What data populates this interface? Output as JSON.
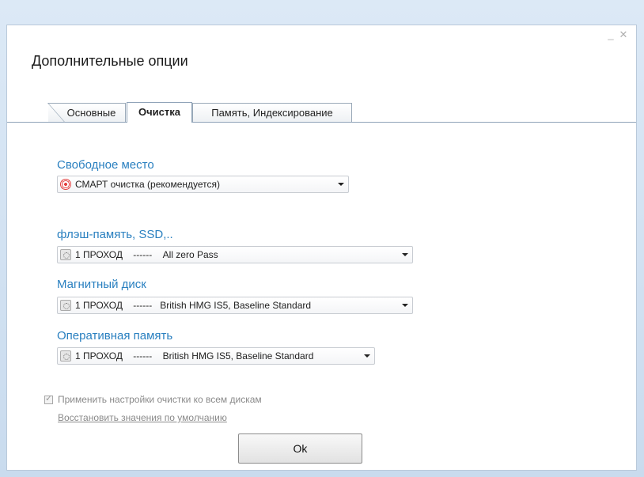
{
  "window": {
    "title": "Дополнительные опции",
    "minimize_glyph": "_",
    "close_glyph": "✕"
  },
  "tabs": [
    {
      "label": "Основные",
      "active": false
    },
    {
      "label": "Очистка",
      "active": true
    },
    {
      "label": "Память, Индексирование",
      "active": false
    }
  ],
  "sections": {
    "free_space": {
      "label": "Свободное место",
      "value": "СМАРТ очистка (рекомендуется)",
      "icon": "target-icon"
    },
    "flash": {
      "label": "флэш-память, SSD,..",
      "value": "1 ПРОХОД    ------    All zero Pass",
      "icon": "gear-icon"
    },
    "magnetic": {
      "label": "Магнитный диск",
      "value": "1 ПРОХОД    ------   British HMG IS5, Baseline Standard",
      "icon": "gear-icon"
    },
    "ram": {
      "label": "Оперативная память",
      "value": "1 ПРОХОД    ------    British HMG IS5, Baseline Standard",
      "icon": "gear-icon"
    }
  },
  "apply_all": {
    "label": "Применить настройки очистки ко всем дискам",
    "checked": true
  },
  "restore_link": "Восстановить значения по умолчанию",
  "ok_button": "Ok"
}
